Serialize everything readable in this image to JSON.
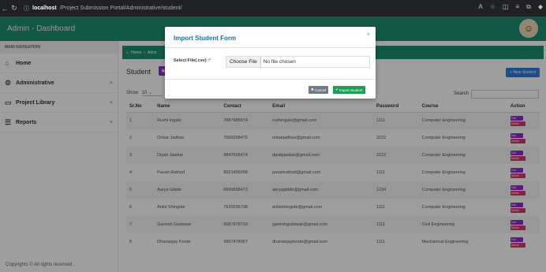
{
  "browser": {
    "host": "localhost",
    "path": "/Project Submission Portal/Administrative/student/"
  },
  "app": {
    "title": "Admin - Dashboard"
  },
  "sidebar": {
    "heading": "MAIN NAVIGATION",
    "items": [
      {
        "label": "Home",
        "icon": "home-icon",
        "expandable": false
      },
      {
        "label": "Administrative",
        "icon": "gear-icon",
        "expandable": true
      },
      {
        "label": "Project Library",
        "icon": "monitor-icon",
        "expandable": true
      },
      {
        "label": "Reports",
        "icon": "list-icon",
        "expandable": true
      }
    ],
    "copyright": "Copyrights © All rights reserved ."
  },
  "breadcrumb": [
    "Home",
    "Admi"
  ],
  "page": {
    "section_title": "Student",
    "new_button": "+ New Student",
    "show_label": "Show",
    "show_value": "10",
    "search_label": "Search"
  },
  "table": {
    "columns": [
      "Sr.No",
      "Name",
      "Contact",
      "Email",
      "Password",
      "Course",
      "Action"
    ],
    "rows": [
      {
        "sr": "1",
        "name": "Rushi Ingale",
        "contact": "7887985874",
        "email": "rushingale@gmail.com",
        "password": "1111",
        "course": "Computer Engineering"
      },
      {
        "sr": "2",
        "name": "Onkar Jadhav",
        "contact": "7666258475",
        "email": "onkarjadhav@gmail.com",
        "password": "2222",
        "course": "Computer Engineering"
      },
      {
        "sr": "3",
        "name": "Dipak Jawkar",
        "contact": "9847568474",
        "email": "dipakjawkar@gmail.com",
        "password": "2222",
        "course": "Computer Engineering"
      },
      {
        "sr": "4",
        "name": "Pavan Rathod",
        "contact": "8921456098",
        "email": "pavanrathod@gmail.com",
        "password": "1111",
        "course": "Computer Engineering"
      },
      {
        "sr": "5",
        "name": "Aarya Gidde",
        "contact": "8999658473",
        "email": "aaryagidde@gmail.com",
        "password": "1234",
        "course": "Computer Engineering"
      },
      {
        "sr": "6",
        "name": "Ankit Shingote",
        "contact": "7620036738",
        "email": "ankitshingote@gmail.com",
        "password": "1111",
        "course": "Computer Engineering"
      },
      {
        "sr": "7",
        "name": "Ganesh Gudewar",
        "contact": "6587978733",
        "email": "ganeshgudewar@gmail.com",
        "password": "1111",
        "course": "Civil Engineering"
      },
      {
        "sr": "8",
        "name": "Dhananjay Korde",
        "contact": "9857478957",
        "email": "dhananjaykorde@gmail.com",
        "password": "1111",
        "course": "Mechanical Engineering"
      }
    ],
    "edit_label": "Edit",
    "delete_label": "Delete"
  },
  "modal": {
    "title": "Import Student Form",
    "close": "×",
    "field_label": "Select File(.csv) :",
    "required_mark": "*",
    "choose_file": "Choose File",
    "no_file": "No file chosen",
    "cancel_label": "Cancel",
    "import_label": "Import Student"
  },
  "colors": {
    "header_green": "#1f8f72",
    "modal_title_blue": "#1c6ea4",
    "edit_purple": "#8e2bd0",
    "delete_pink": "#d9366b",
    "import_green": "#1f9d55"
  }
}
